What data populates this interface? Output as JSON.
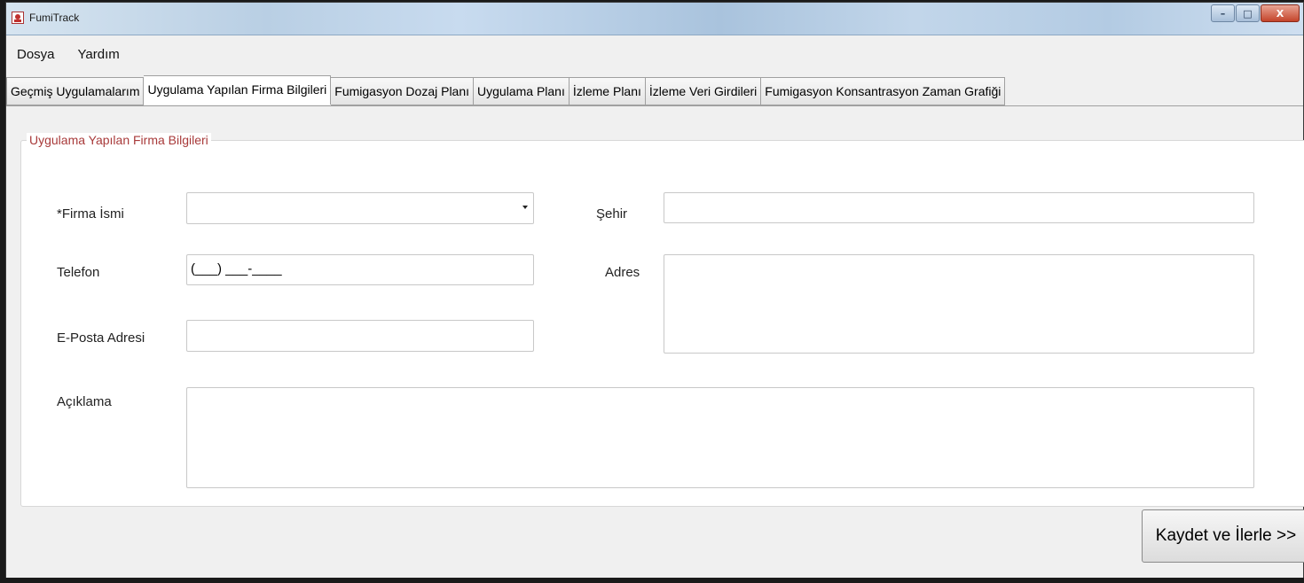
{
  "window": {
    "title": "FumiTrack",
    "controls": {
      "minimize": "–",
      "maximize": "□",
      "close": "X"
    }
  },
  "menu": [
    "Dosya",
    "Yardım"
  ],
  "tabs": [
    {
      "label": "Geçmiş Uygulamalarım",
      "active": false
    },
    {
      "label": "Uygulama Yapılan Firma Bilgileri",
      "active": true
    },
    {
      "label": "Fumigasyon Dozaj Planı",
      "active": false
    },
    {
      "label": "Uygulama Planı",
      "active": false
    },
    {
      "label": "İzleme Planı",
      "active": false
    },
    {
      "label": "İzleme Veri Girdileri",
      "active": false
    },
    {
      "label": "Fumigasyon Konsantrasyon Zaman Grafiği",
      "active": false
    }
  ],
  "form": {
    "group_title": "Uygulama Yapılan Firma Bilgileri",
    "firma_label": "*Firma İsmi",
    "firma_value": "",
    "telefon_label": "Telefon",
    "telefon_mask": "(___) ___-____",
    "eposta_label": "E-Posta Adresi",
    "eposta_value": "",
    "sehir_label": "Şehir",
    "sehir_value": "",
    "adres_label": "Adres",
    "adres_value": "",
    "aciklama_label": "Açıklama",
    "aciklama_value": ""
  },
  "actions": {
    "save_label": "Kaydet ve İlerle >>"
  }
}
